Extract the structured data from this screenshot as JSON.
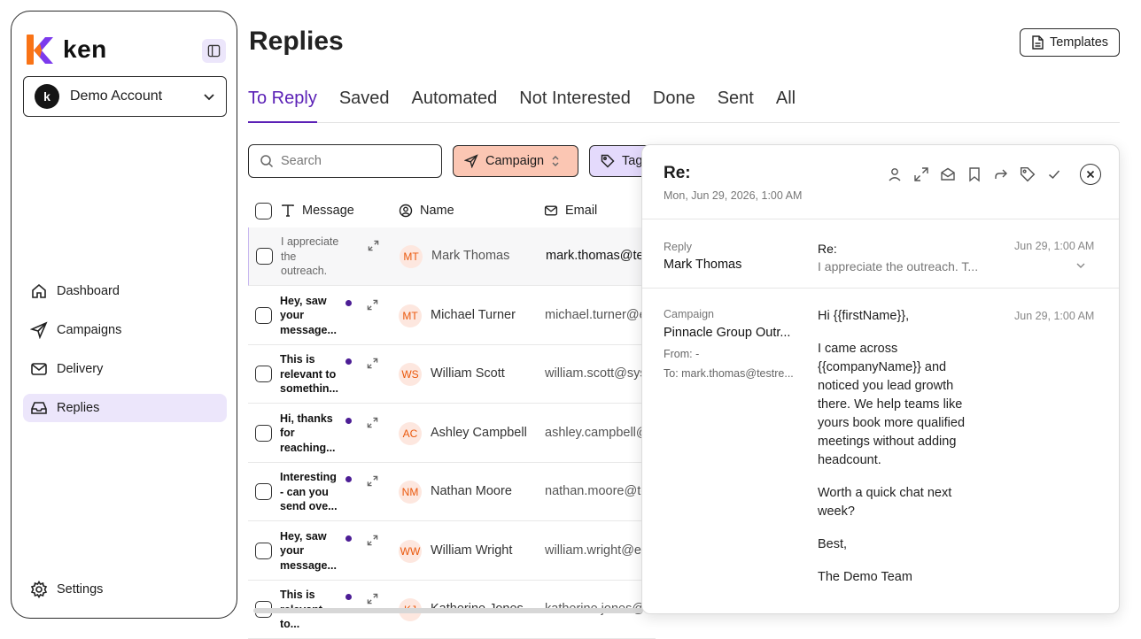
{
  "brand": {
    "name": "ken",
    "accent": "#5b21b6",
    "logo_orange": "#f97316",
    "logo_purple": "#7c3aed"
  },
  "account": {
    "avatar_letter": "k",
    "name": "Demo Account"
  },
  "nav": {
    "dashboard": "Dashboard",
    "campaigns": "Campaigns",
    "delivery": "Delivery",
    "replies": "Replies",
    "settings": "Settings"
  },
  "header": {
    "title": "Replies",
    "templates_label": "Templates"
  },
  "tabs": [
    "To Reply",
    "Saved",
    "Automated",
    "Not Interested",
    "Done",
    "Sent",
    "All"
  ],
  "filters": {
    "search_placeholder": "Search",
    "campaign": "Campaign",
    "tag": "Tag"
  },
  "table": {
    "columns": {
      "message": "Message",
      "name": "Name",
      "email": "Email"
    },
    "rows": [
      {
        "message": "I appreciate the outreach. This actuall...",
        "initials": "MT",
        "name": "Mark Thomas",
        "email": "mark.thomas@testreply.com",
        "unread": false,
        "selected": true
      },
      {
        "message": "Hey, saw your message...",
        "initials": "MT",
        "name": "Michael Turner",
        "email": "michael.turner@example.com",
        "unread": true,
        "selected": false
      },
      {
        "message": "This is relevant to somethin...",
        "initials": "WS",
        "name": "William Scott",
        "email": "william.scott@sysco.com",
        "unread": true,
        "selected": false
      },
      {
        "message": "Hi, thanks for reaching...",
        "initials": "AC",
        "name": "Ashley Campbell",
        "email": "ashley.campbell@example.com",
        "unread": true,
        "selected": false
      },
      {
        "message": "Interesting - can you send ove...",
        "initials": "NM",
        "name": "Nathan Moore",
        "email": "nathan.moore@testreply.com",
        "unread": true,
        "selected": false
      },
      {
        "message": "Hey, saw your message...",
        "initials": "WW",
        "name": "William Wright",
        "email": "william.wright@example.com",
        "unread": true,
        "selected": false
      },
      {
        "message": "This is relevant to...",
        "initials": "KJ",
        "name": "Katherine Jones",
        "email": "katherine.jones@example.com",
        "unread": true,
        "selected": false
      }
    ]
  },
  "panel": {
    "title": "Re:",
    "date": "Mon, Jun 29, 2026, 1:00 AM",
    "reply": {
      "label": "Reply",
      "sender": "Mark Thomas",
      "subject": "Re:",
      "preview": "I appreciate the outreach. T...",
      "time": "Jun 29, 1:00 AM"
    },
    "campaign": {
      "label": "Campaign",
      "name": "Pinnacle Group Outr...",
      "from": "From: -",
      "to": "To: mark.thomas@testre...",
      "time": "Jun 29, 1:00 AM"
    },
    "body": [
      "Hi {{firstName}},",
      "I came across {{companyName}} and noticed you lead growth there. We help teams like yours book more qualified meetings without adding headcount.",
      "Worth a quick chat next week?",
      "Best,",
      "The Demo Team"
    ]
  }
}
